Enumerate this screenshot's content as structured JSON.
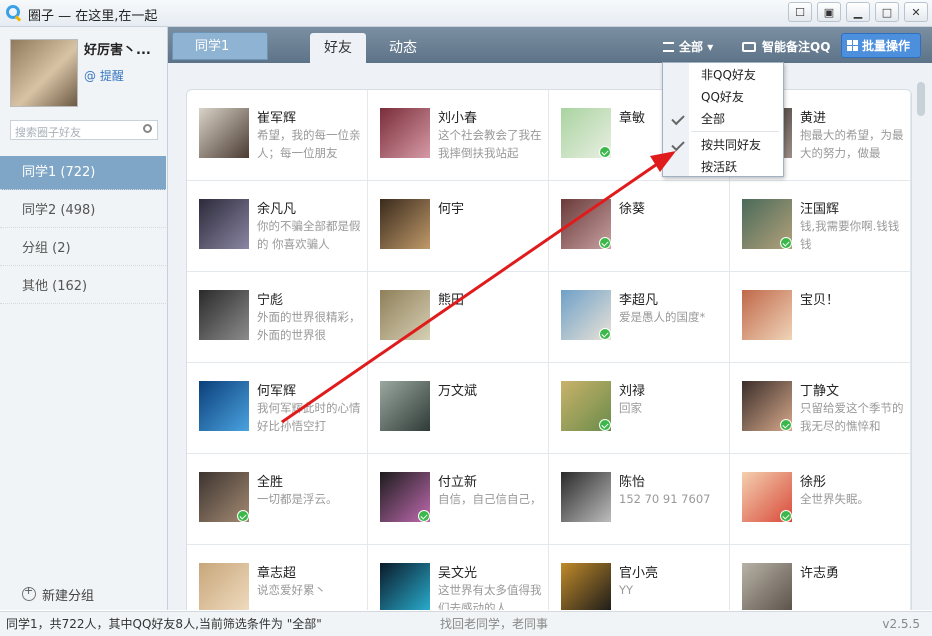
{
  "window": {
    "title": "圈子 — 在这里,在一起"
  },
  "profile": {
    "name": "好厉害丶...",
    "remind": "提醒"
  },
  "search": {
    "placeholder": "搜索圈子好友"
  },
  "groups": [
    {
      "label": "同学1 (722)",
      "active": true
    },
    {
      "label": "同学2 (498)",
      "active": false
    },
    {
      "label": "分组 (2)",
      "active": false
    },
    {
      "label": "其他 (162)",
      "active": false
    }
  ],
  "new_group_label": "新建分组",
  "topbar": {
    "group_tab": "同学1",
    "tabs": [
      "好友",
      "动态"
    ],
    "filter_label": "全部",
    "remark_label": "智能备注QQ",
    "batch_label": "批量操作"
  },
  "filter_menu": {
    "items": [
      "非QQ好友",
      "QQ好友",
      "全部",
      "按共同好友",
      "按活跃"
    ],
    "checked": [
      "全部",
      "按共同好友"
    ]
  },
  "friends": [
    {
      "name": "崔军辉",
      "sig": "希望，我的每一位亲人；每一位朋友",
      "verified": false,
      "colors": [
        "#d9d3c8",
        "#4b3b32"
      ]
    },
    {
      "name": "刘小春",
      "sig": "这个社会教会了我在我摔倒扶我站起",
      "verified": false,
      "colors": [
        "#7a2d3a",
        "#d69aa6"
      ]
    },
    {
      "name": "章敏",
      "sig": "",
      "verified": true,
      "colors": [
        "#a9d3a0",
        "#e9efe2"
      ]
    },
    {
      "name": "黄进",
      "sig": "抱最大的希望，为最大的努力，做最",
      "verified": false,
      "colors": [
        "#2f2a28",
        "#9b8e86"
      ]
    },
    {
      "name": "余凡凡",
      "sig": "你的不骗全部都是假的 你喜欢骗人",
      "verified": false,
      "colors": [
        "#2c2a3a",
        "#8a86a3"
      ]
    },
    {
      "name": "何宇",
      "sig": "",
      "verified": false,
      "colors": [
        "#3a2a1c",
        "#c09a6a"
      ]
    },
    {
      "name": "徐葵",
      "sig": "",
      "verified": true,
      "colors": [
        "#6a3a3a",
        "#c7a0a0"
      ]
    },
    {
      "name": "汪国辉",
      "sig": "钱,我需要你啊.钱钱钱",
      "verified": true,
      "colors": [
        "#4a6a5a",
        "#b3a17a"
      ]
    },
    {
      "name": "宁彪",
      "sig": "外面的世界很精彩，外面的世界很",
      "verified": false,
      "colors": [
        "#2a2a2a",
        "#8c8c8c"
      ]
    },
    {
      "name": "熊田",
      "sig": "",
      "verified": false,
      "colors": [
        "#8f7f5a",
        "#d7d0b4"
      ]
    },
    {
      "name": "李超凡",
      "sig": "爱是愚人的国度*",
      "verified": true,
      "colors": [
        "#6fa0c8",
        "#e8e2d6"
      ]
    },
    {
      "name": "宝贝！",
      "sig": "",
      "verified": false,
      "colors": [
        "#c0684a",
        "#f0d4b8"
      ]
    },
    {
      "name": "何军辉",
      "sig": "我何军辉此时的心情好比孙悟空打",
      "verified": false,
      "colors": [
        "#0b3f7a",
        "#4aa3e0"
      ]
    },
    {
      "name": "万文斌",
      "sig": "",
      "verified": false,
      "colors": [
        "#9aa8a0",
        "#2f3a36"
      ]
    },
    {
      "name": "刘禄",
      "sig": "回家",
      "verified": true,
      "colors": [
        "#c9b26a",
        "#6a8c4a"
      ]
    },
    {
      "name": "丁静文",
      "sig": "只留给爱这个季节的我无尽的憔悴和",
      "verified": true,
      "colors": [
        "#3a2e2a",
        "#d6a88a"
      ]
    },
    {
      "name": "全胜",
      "sig": "一切都是浮云。",
      "verified": true,
      "colors": [
        "#3c3430",
        "#a48a72"
      ]
    },
    {
      "name": "付立新",
      "sig": "自信，自己信自己，",
      "verified": true,
      "colors": [
        "#1c1c1c",
        "#c06ab0"
      ]
    },
    {
      "name": "陈怡",
      "sig": "152 70 91 7607",
      "verified": false,
      "colors": [
        "#2a2a2a",
        "#bdbdbd"
      ]
    },
    {
      "name": "徐彤",
      "sig": "全世界失眠。",
      "verified": true,
      "colors": [
        "#f4d0b0",
        "#d84a3a"
      ]
    },
    {
      "name": "章志超",
      "sig": "说恋爱好累丶",
      "verified": false,
      "colors": [
        "#c8a67a",
        "#f0dcc0"
      ]
    },
    {
      "name": "吴文光",
      "sig": "这世界有太多值得我们去感动的人",
      "verified": false,
      "colors": [
        "#0a1a2a",
        "#2ab0d0"
      ]
    },
    {
      "name": "官小亮",
      "sig": "YY",
      "verified": false,
      "colors": [
        "#c08a2a",
        "#1a1a1a"
      ]
    },
    {
      "name": "许志勇",
      "sig": "",
      "verified": false,
      "colors": [
        "#b8b2a6",
        "#5a5048"
      ]
    }
  ],
  "status": {
    "left": "同学1，共722人，其中QQ好友8人,当前筛选条件为 \"全部\"",
    "middle": "找回老同学，老同事",
    "version": "v2.5.5"
  }
}
